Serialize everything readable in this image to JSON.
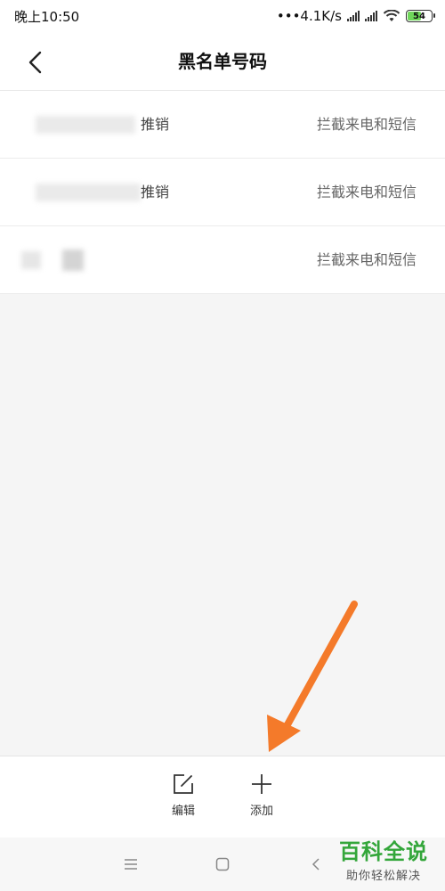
{
  "status_bar": {
    "time": "晚上10:50",
    "network_speed": "•••4.1K/s",
    "battery_level": "54",
    "icons": [
      "signal-icon",
      "signal-icon",
      "wifi-icon",
      "battery-icon"
    ]
  },
  "header": {
    "title": "黑名单号码",
    "back_icon": "chevron-left-icon"
  },
  "blacklist": {
    "items": [
      {
        "number": "推销",
        "mode": "拦截来电和短信"
      },
      {
        "number": "推销",
        "mode": "拦截来电和短信"
      },
      {
        "number": "",
        "mode": "拦截来电和短信"
      }
    ]
  },
  "toolbar": {
    "edit_label": "编辑",
    "edit_icon": "edit-icon",
    "add_label": "添加",
    "add_icon": "plus-icon"
  },
  "navbar": {
    "icons": [
      "menu-icon",
      "home-square-icon",
      "back-chevron-icon"
    ]
  },
  "watermark": {
    "title": "百科全说",
    "subtitle": "助你轻松解决"
  },
  "colors": {
    "accent_arrow": "#f47a2a",
    "watermark_green": "#33a63a",
    "battery_green": "#6fd65a"
  }
}
